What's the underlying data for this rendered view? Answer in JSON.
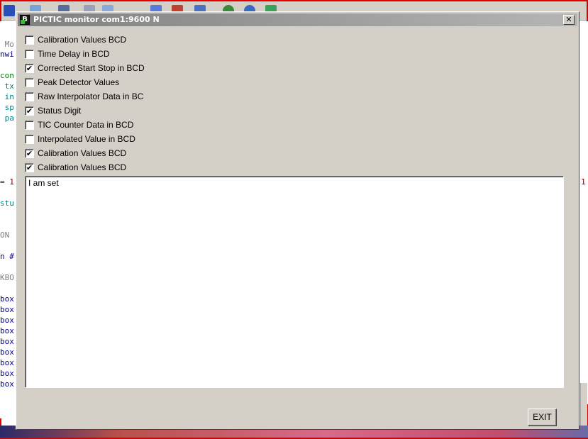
{
  "dialog": {
    "title": "PICTIC monitor  com1:9600 N",
    "app_icon_glyph": "B",
    "close_glyph": "✕",
    "checkboxes": [
      {
        "label": "Calibration Values BCD",
        "checked": false
      },
      {
        "label": "Time Delay in BCD",
        "checked": false
      },
      {
        "label": "Corrected Start Stop in BCD",
        "checked": true
      },
      {
        "label": "Peak Detector Values",
        "checked": false
      },
      {
        "label": "Raw Interpolator Data in BC",
        "checked": false
      },
      {
        "label": "Status Digit",
        "checked": true
      },
      {
        "label": "TIC Counter Data in BCD",
        "checked": false
      },
      {
        "label": "Interpolated Value in BCD",
        "checked": false
      },
      {
        "label": "Calibration Values BCD",
        "checked": true
      },
      {
        "label": "Calibration Values BCD",
        "checked": true
      }
    ],
    "output_text": "I am set",
    "exit_label": "EXIT"
  },
  "background_editor": {
    "code_fragments": [
      {
        "text": " Mo",
        "color": "#808080"
      },
      {
        "text": "nwi",
        "color": "#000080"
      },
      {
        "text": "con",
        "color": "#008000"
      },
      {
        "text": " tx",
        "color": "#008080"
      },
      {
        "text": " in",
        "color": "#008080"
      },
      {
        "text": " sp",
        "color": "#008080"
      },
      {
        "text": " pa",
        "color": "#008080"
      },
      {
        "text": "= 1",
        "color": "#800000"
      },
      {
        "text": "stu",
        "color": "#008080"
      },
      {
        "text": "ON",
        "color": "#808080"
      },
      {
        "text": "n #",
        "color": "#000080"
      },
      {
        "text": "KBO",
        "color": "#808080"
      },
      {
        "text": "box",
        "color": "#0000a0"
      },
      {
        "text": "box",
        "color": "#0000a0"
      },
      {
        "text": "box",
        "color": "#0000a0"
      },
      {
        "text": "box",
        "color": "#0000a0"
      },
      {
        "text": "box",
        "color": "#0000a0"
      },
      {
        "text": "box",
        "color": "#0000a0"
      },
      {
        "text": "box",
        "color": "#0000a0"
      },
      {
        "text": "box",
        "color": "#0000a0"
      },
      {
        "text": "box",
        "color": "#0000a0"
      }
    ],
    "right_fragment": "1"
  },
  "colors": {
    "frame_red": "#e00000",
    "dialog_face": "#d4d0c8",
    "titlebar_inactive": "#808080"
  }
}
